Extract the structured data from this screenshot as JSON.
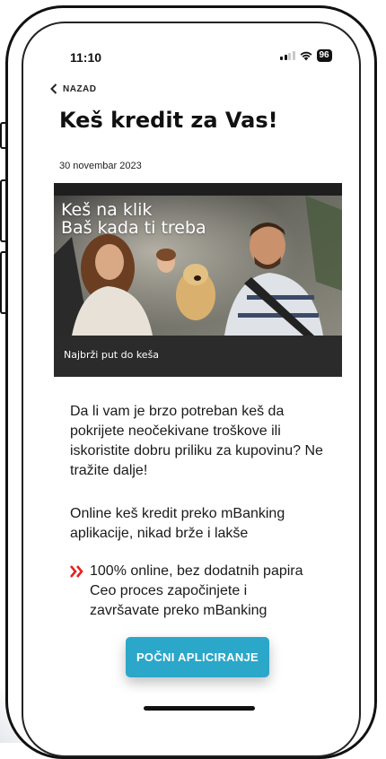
{
  "status_bar": {
    "time": "11:10",
    "battery": "96"
  },
  "nav": {
    "back_label": "NAZAD"
  },
  "article": {
    "title": "Keš kredit za Vas!",
    "date": "30 novembar 2023",
    "banner": {
      "headline_line1": "Keš na klik",
      "headline_line2": "Baš kada ti treba",
      "caption": "Najbrži put do keša"
    },
    "paragraph1": "Da li vam je brzo potreban keš da pokrijete neočekivane troškove ili iskoristite dobru priliku za kupovinu? Ne tražite dalje!",
    "paragraph2": "Online keš kredit preko mBanking aplikacije, nikad brže i lakše",
    "bullet": {
      "line1": "100% online, bez dodatnih papira",
      "line2": "Ceo proces započinjete i",
      "line3": "završavate preko mBanking"
    }
  },
  "cta": {
    "label": "POČNI APLICIRANJE"
  },
  "colors": {
    "accent": "#2aa7c9",
    "bullet": "#e32321",
    "banner_caption_bg": "#2b2b2b"
  },
  "icons": [
    "signal-icon",
    "wifi-icon",
    "battery-icon",
    "chevron-left-icon",
    "double-chevron-right-icon"
  ]
}
